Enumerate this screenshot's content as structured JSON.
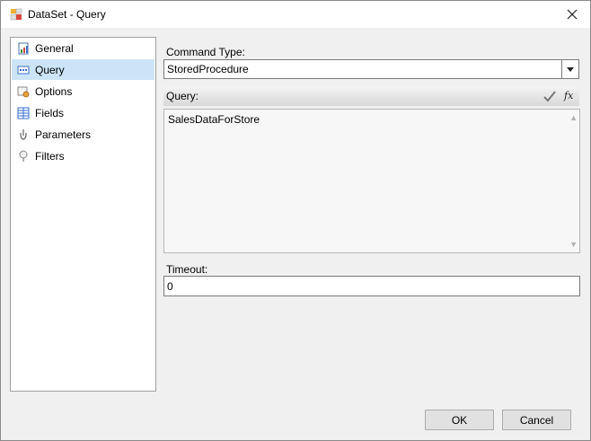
{
  "window": {
    "title": "DataSet - Query"
  },
  "sidebar": {
    "items": [
      {
        "label": "General",
        "icon": "general-icon"
      },
      {
        "label": "Query",
        "icon": "query-icon",
        "selected": true
      },
      {
        "label": "Options",
        "icon": "options-icon"
      },
      {
        "label": "Fields",
        "icon": "fields-icon"
      },
      {
        "label": "Parameters",
        "icon": "parameters-icon"
      },
      {
        "label": "Filters",
        "icon": "filters-icon"
      }
    ]
  },
  "form": {
    "command_type_label": "Command Type:",
    "command_type_value": "StoredProcedure",
    "query_label": "Query:",
    "query_value": "SalesDataForStore",
    "timeout_label": "Timeout:",
    "timeout_value": "0"
  },
  "buttons": {
    "ok": "OK",
    "cancel": "Cancel"
  },
  "colors": {
    "selected_bg": "#cce4f7",
    "window_bg": "#f0f0f0"
  }
}
